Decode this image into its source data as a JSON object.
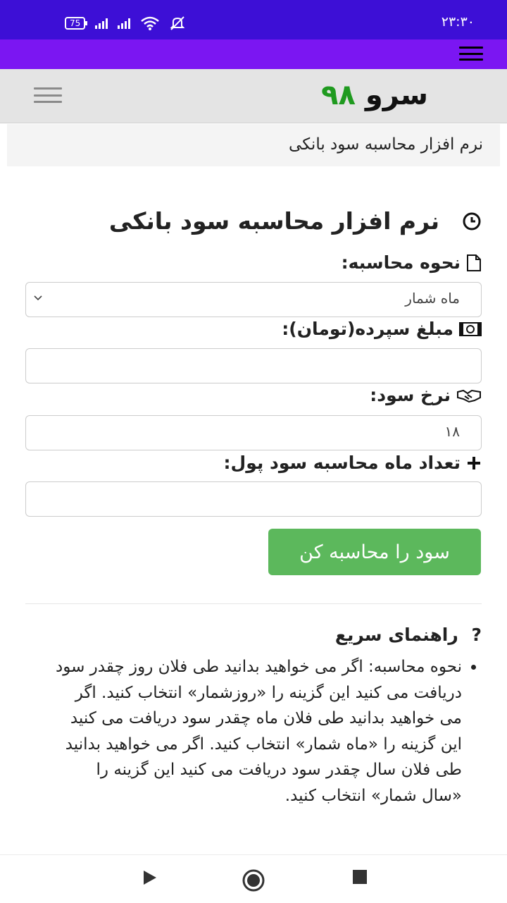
{
  "status_bar": {
    "time": "۲۳:۳۰",
    "battery": "75"
  },
  "site": {
    "logo_text": "سرو",
    "logo_number": "۹۸"
  },
  "breadcrumb": {
    "text": "نرم افزار محاسبه سود بانکی"
  },
  "page": {
    "title": "نرم افزار محاسبه سود بانکی"
  },
  "form": {
    "method_label": "نحوه محاسبه:",
    "method_selected": "ماه شمار",
    "amount_label": "مبلغ سپرده(تومان):",
    "amount_value": "",
    "rate_label": "نرخ سود:",
    "rate_value": "۱۸",
    "months_label": "تعداد ماه محاسبه سود پول:",
    "months_value": "",
    "submit_label": "سود را محاسبه کن"
  },
  "help": {
    "title": "راهنمای سریع",
    "items": [
      "نحوه محاسبه: اگر می خواهید بدانید طی فلان روز چقدر سود دریافت می کنید این گزینه را «روزشمار» انتخاب کنید. اگر می خواهید بدانید طی فلان ماه چقدر سود دریافت می کنید این گزینه را «ماه شمار» انتخاب کنید. اگر می خواهید بدانید طی فلان سال چقدر سود دریافت می کنید این گزینه را «سال شمار» انتخاب کنید."
    ]
  },
  "icons": {
    "clock": "clock-icon",
    "document": "document-icon",
    "money": "money-icon",
    "handshake": "handshake-icon",
    "plus": "plus-icon",
    "question": "question-icon"
  },
  "colors": {
    "status_bar": "#3d0fd6",
    "app_bar": "#7b16f2",
    "button": "#5cb85c",
    "logo_number": "#1f9a1f"
  }
}
